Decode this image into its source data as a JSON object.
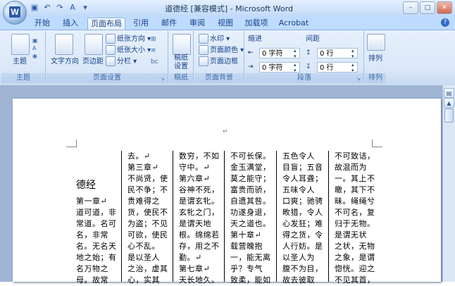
{
  "window": {
    "title": "道德经 [兼容模式] - Microsoft Word",
    "buttons": [
      "–",
      "□",
      "✕"
    ]
  },
  "qat": {
    "save_icon": "save-icon",
    "undo_icon": "undo-icon",
    "redo_icon": "redo-icon"
  },
  "tabs": [
    "开始",
    "插入",
    "页面布局",
    "引用",
    "邮件",
    "审阅",
    "视图",
    "加载项",
    "Acrobat"
  ],
  "active_tab": "页面布局",
  "ribbon": {
    "theme_group": {
      "label": "主题",
      "themes_btn": "主题"
    },
    "page_setup": {
      "label": "页面设置",
      "text_direction": "文字方向",
      "margins": "页边距",
      "orientation": "纸张方向",
      "size": "纸张大小",
      "columns": "分栏"
    },
    "draft_paper": {
      "label": "稿纸",
      "btn": "稿纸\n设置"
    },
    "page_background": {
      "label": "页面背景",
      "watermark": "水印",
      "page_color": "页面颜色",
      "page_border": "页面边框"
    },
    "paragraph": {
      "label": "段落",
      "indent_title": "缩进",
      "spacing_title": "间距",
      "indent_left_value": "0 字符",
      "indent_right_value": "0 字符",
      "spacing_before_value": "0 行",
      "spacing_after_value": "0 行"
    },
    "arrange": {
      "label": "排列",
      "btn": "排列"
    }
  },
  "document": {
    "heading": "德经",
    "columns": [
      "第一章↵\n道可道，非\n常道。名可\n名，非常\n名。无名天\n地之始；有\n名万物之\n母。故常",
      "去。↵\n第三章↵\n不尚贤，使\n民不争；不\n贵难得之\n货，使民不\n为盗；不见\n可欲，使民\n心不乱。\n是以圣人\n之治，虚其\n心，实其",
      "数穷，不如\n守中。↵\n第六章↵\n谷神不死，\n是谓玄牝。\n玄牝之门，\n是谓天地\n根。绵绵若\n存，用之不\n勤。↵\n第七章↵\n天长地久。",
      "不可长保。\n金玉满堂，\n莫之能守；\n富贵而骄，\n自遗其咎。\n功遂身退，\n天之道也。\n第十章↵\n载营魄抱\n一，能无离\n乎？专气\n致柔，能如",
      "五色令人\n目盲；五音\n令人耳聋；\n五味令人\n口爽；驰骋\n畋猎，令人\n心发狂；难\n得之货，令\n人行妨。是\n以圣人为\n腹不为目，\n故去彼取",
      "不可致诘，\n故混而为\n一。其上不\n皦，其下不\n昧。绳绳兮\n不可名，复\n归于无物。\n是谓无状\n之状，无物\n之象，是谓\n惚恍。迎之\n不见其首，"
    ],
    "top_mark": "↵"
  }
}
